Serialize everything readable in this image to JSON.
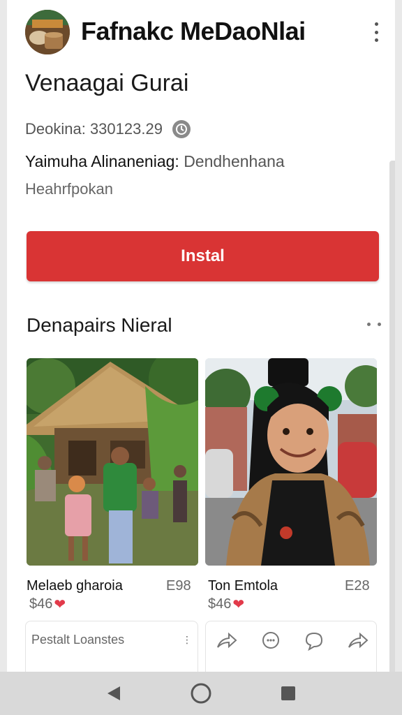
{
  "header": {
    "app_title": "Fafnakc MeDaoNlai",
    "avatar_icon": "app-avatar-image",
    "menu_icon": "kebab-menu-icon"
  },
  "app": {
    "subtitle": "Venaagai Gurai",
    "downloads": "Deokina: 330123.29",
    "downloads_icon": "clock-icon",
    "developer_label": "Yaimuha Alinaneniag:",
    "developer_value": "Dendhenhana",
    "category": "Heahrfpokan"
  },
  "install": {
    "label": "Instal",
    "color": "#d93434"
  },
  "section": {
    "title": "Denapairs Nieral",
    "more_icon": "more-dots-icon"
  },
  "cards": [
    {
      "name": "Melaeb gharoia",
      "size": "E98",
      "price": "$46",
      "image": "village-hut-photo"
    },
    {
      "name": "Ton Emtola",
      "size": "E28",
      "price": "$46",
      "image": "girl-portrait-photo"
    }
  ],
  "mini_cards": [
    {
      "label": "Pestalt Loanstes"
    }
  ],
  "share_icons": [
    "share-icon",
    "chat-bubble-icon",
    "comment-icon",
    "forward-icon"
  ],
  "navbar": {
    "back": "back-icon",
    "home": "home-icon",
    "recents": "recents-icon"
  }
}
